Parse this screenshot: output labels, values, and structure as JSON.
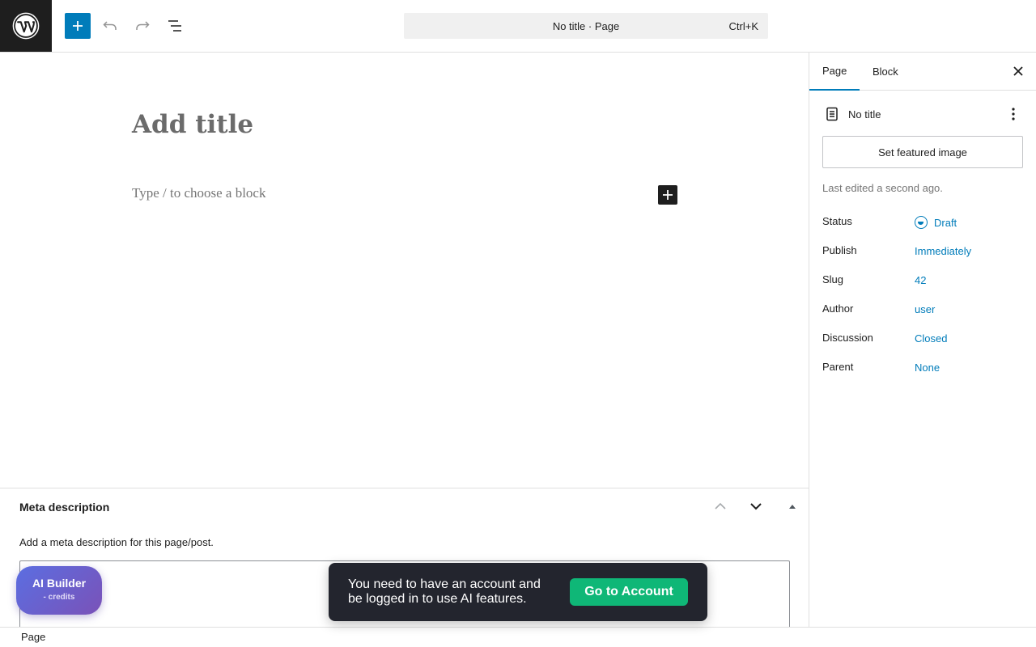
{
  "topbar": {
    "command_title": "No title · Page",
    "command_shortcut": "Ctrl+K"
  },
  "editor": {
    "title_placeholder": "Add title",
    "block_placeholder": "Type / to choose a block"
  },
  "sidebar": {
    "tabs": [
      {
        "label": "Page",
        "active": true
      },
      {
        "label": "Block",
        "active": false
      }
    ],
    "doc_title": "No title",
    "featured_image_label": "Set featured image",
    "last_edited": "Last edited a second ago.",
    "properties": [
      {
        "label": "Status",
        "value": "Draft"
      },
      {
        "label": "Publish",
        "value": "Immediately"
      },
      {
        "label": "Slug",
        "value": "42"
      },
      {
        "label": "Author",
        "value": "user"
      },
      {
        "label": "Discussion",
        "value": "Closed"
      },
      {
        "label": "Parent",
        "value": "None"
      }
    ]
  },
  "metabox": {
    "title": "Meta description",
    "description": "Add a meta description for this page/post.",
    "textarea_value": ""
  },
  "statusbar": {
    "breadcrumb": "Page"
  },
  "ai_builder": {
    "title": "AI Builder",
    "subtitle": "- credits"
  },
  "snackbar": {
    "message": "You need to have an account and be logged in to use AI features.",
    "button_label": "Go to Account"
  },
  "colors": {
    "accent": "#007cba",
    "snackbar_bg": "#23252e",
    "snackbar_button": "#0fb777",
    "topbar_logo_bg": "#1e1e1e"
  },
  "icons": [
    "wordpress-logo",
    "plus-icon",
    "undo-icon",
    "redo-icon",
    "list-view-icon",
    "close-icon",
    "page-icon",
    "more-vertical-icon",
    "status-draft-icon",
    "chevron-up-icon",
    "chevron-down-icon",
    "caret-up-icon"
  ]
}
